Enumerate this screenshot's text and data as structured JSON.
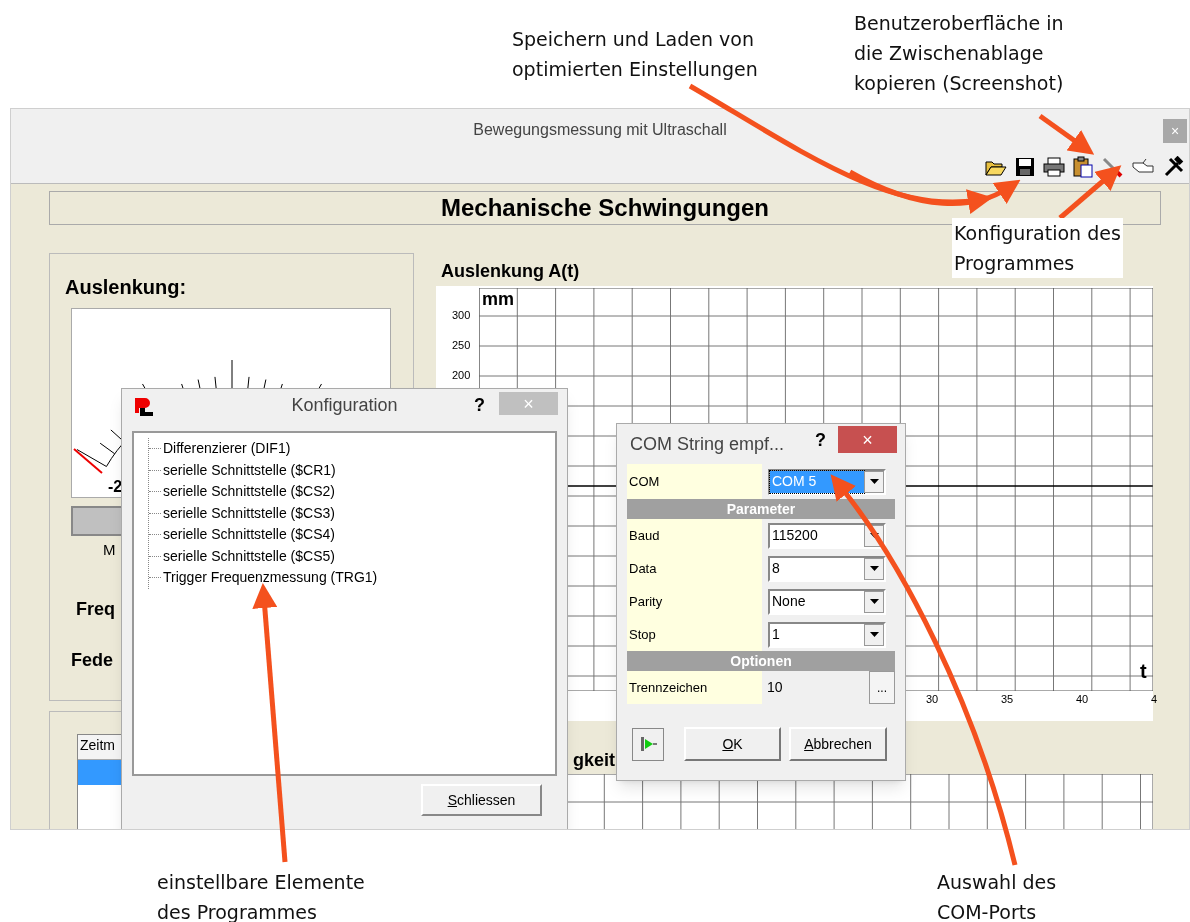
{
  "window": {
    "title": "Bewegungsmessung mit Ultraschall",
    "close": "×"
  },
  "header": "Mechanische Schwingungen",
  "left_panel": {
    "title": "Auslenkung:",
    "gauge_label": "-2",
    "bar_caption": "M",
    "labels": [
      "Freq",
      "Fede"
    ]
  },
  "list": {
    "column": "Zeitm",
    "rows": [
      {
        "selected": true
      }
    ]
  },
  "chart": {
    "title": "Auslenkung A(t)",
    "y_unit": "mm",
    "x_unit": "t",
    "yticks": [
      "300",
      "250",
      "200"
    ],
    "xticks": [
      "30",
      "35",
      "40",
      "4"
    ]
  },
  "chart_2": {
    "title": "gkeit"
  },
  "config_dialog": {
    "title": "Konfiguration",
    "help": "?",
    "close": "×",
    "items": [
      {
        "label": "Differenzierer (DIF1)"
      },
      {
        "label": "serielle Schnittstelle ($CR1)"
      },
      {
        "label": "serielle Schnittstelle ($CS2)"
      },
      {
        "label": "serielle Schnittstelle ($CS3)"
      },
      {
        "label": "serielle Schnittstelle ($CS4)"
      },
      {
        "label": "serielle Schnittstelle ($CS5)"
      },
      {
        "label": "Trigger Frequenzmessung (TRG1)"
      }
    ],
    "button": "Schliessen"
  },
  "com_dialog": {
    "title": "COM String empf...",
    "help": "?",
    "close": "×",
    "rows": [
      {
        "kind": "select",
        "label": "COM",
        "value": "COM 5",
        "selected": true
      },
      {
        "kind": "section",
        "label": "Parameter"
      },
      {
        "kind": "select",
        "label": "Baud",
        "value": "115200",
        "selected": false
      },
      {
        "kind": "select",
        "label": "Data",
        "value": "8",
        "selected": false
      },
      {
        "kind": "select",
        "label": "Parity",
        "value": "None",
        "selected": false
      },
      {
        "kind": "select",
        "label": "Stop",
        "value": "1",
        "selected": false
      },
      {
        "kind": "section",
        "label": "Optionen"
      },
      {
        "kind": "ellipsis",
        "label": "Trennzeichen",
        "value": "10",
        "button": "..."
      }
    ],
    "buttons": [
      "OK",
      "Abbrechen"
    ]
  },
  "annotations": [
    {
      "lines": [
        "Speichern und Laden von",
        "optimierten Einstellungen"
      ]
    },
    {
      "lines": [
        "Benutzeroberfläche in",
        "die Zwischenablage",
        "kopieren (Screenshot)"
      ]
    },
    {
      "lines": [
        "Konfiguration des",
        "Programmes"
      ]
    },
    {
      "lines": [
        "einstellbare Elemente",
        "des Programmes"
      ]
    },
    {
      "lines": [
        "Auswahl des",
        "COM-Ports"
      ]
    }
  ]
}
